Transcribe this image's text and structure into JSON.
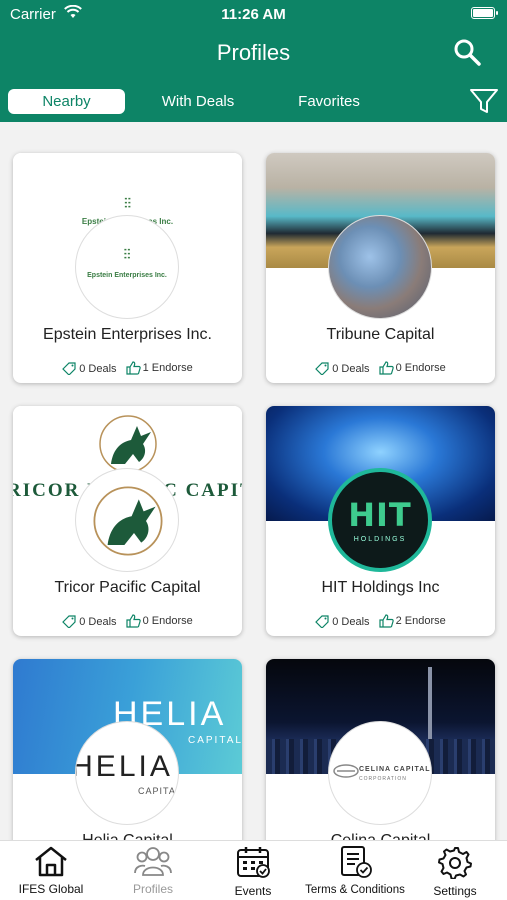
{
  "status": {
    "carrier": "Carrier",
    "time": "11:26 AM"
  },
  "header": {
    "title": "Profiles"
  },
  "tabs": {
    "nearby": "Nearby",
    "with_deals": "With Deals",
    "favorites": "Favorites"
  },
  "cards": [
    {
      "name": "Epstein Enterprises Inc.",
      "deals": "0 Deals",
      "endorse": "1 Endorse",
      "cover_text": "Epstein Enterprises Inc.",
      "logo_text": "Epstein Enterprises Inc."
    },
    {
      "name": "Tribune Capital",
      "deals": "0 Deals",
      "endorse": "0 Endorse"
    },
    {
      "name": "Tricor Pacific Capital",
      "deals": "0 Deals",
      "endorse": "0 Endorse",
      "cover_text": "RICOR PACIFIC CAPITA"
    },
    {
      "name": "HIT Holdings Inc",
      "deals": "0 Deals",
      "endorse": "2 Endorse",
      "logo_text": "HIT",
      "logo_sub": "HOLDINGS"
    },
    {
      "name": "Helia Capital",
      "cover_text": "HELIA",
      "cover_sub": "CAPITAL",
      "logo_text": "HELIA",
      "logo_sub": "CAPITAL"
    },
    {
      "name": "Celina Capital",
      "logo_text": "CELINA CAPITAL",
      "logo_sub": "CORPORATION"
    }
  ],
  "tabbar": {
    "home": "IFES Global",
    "profiles": "Profiles",
    "events": "Events",
    "terms": "Terms & Conditions",
    "settings": "Settings"
  },
  "colors": {
    "primary": "#0d8466",
    "active_tab_text": "#0d8466"
  }
}
